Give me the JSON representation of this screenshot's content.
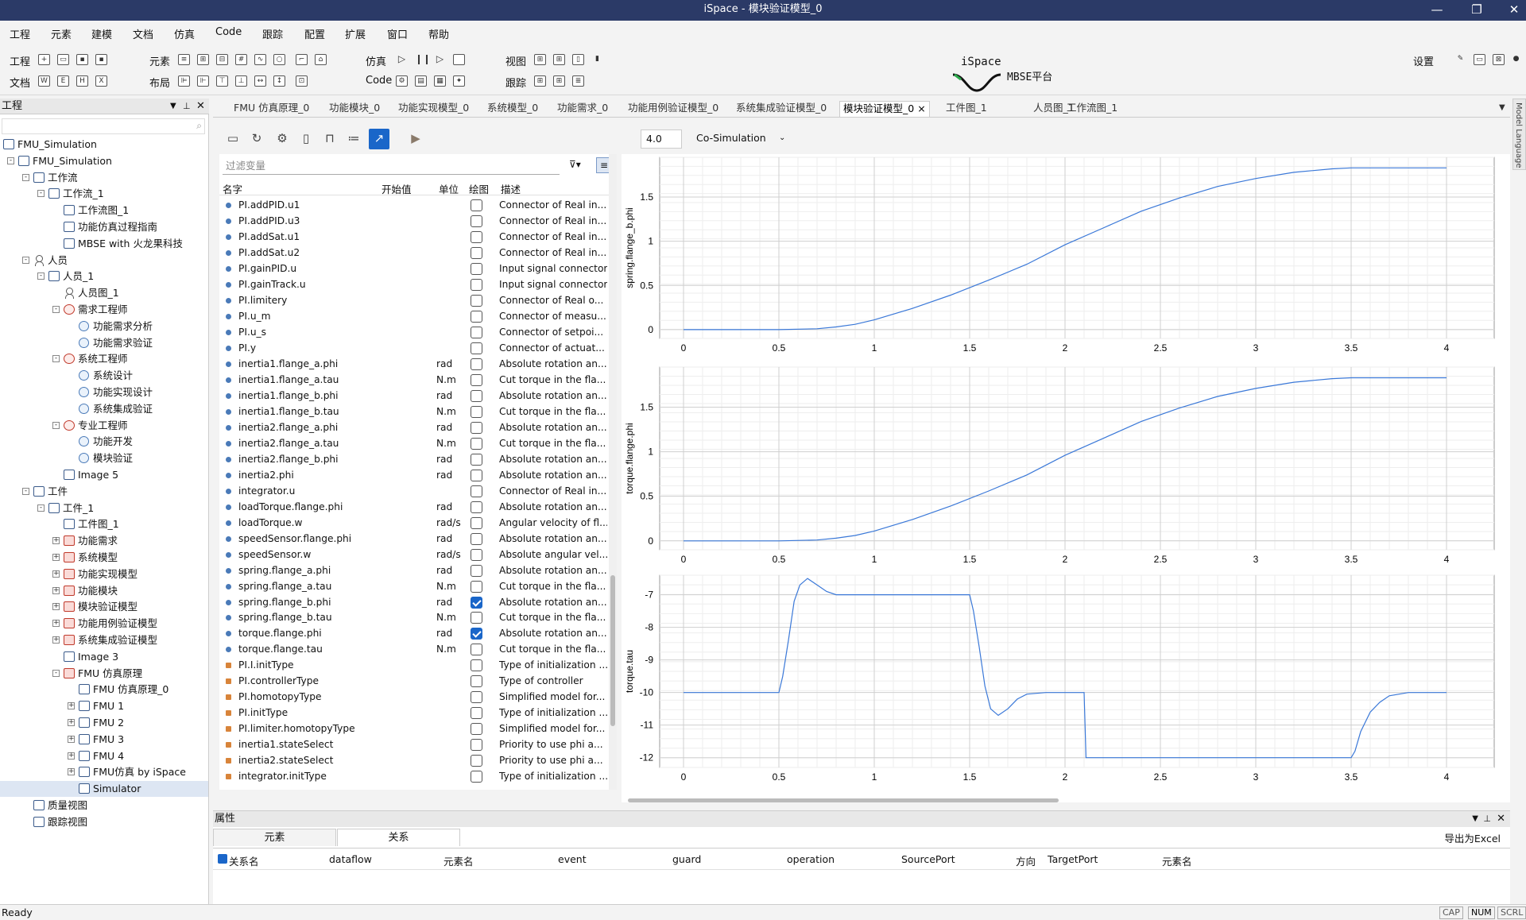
{
  "window": {
    "title": "iSpace - 模块验证模型_0"
  },
  "menu": [
    "工程",
    "元素",
    "建模",
    "文档",
    "仿真",
    "Code",
    "跟踪",
    "配置",
    "扩展",
    "窗口",
    "帮助"
  ],
  "toolbar": {
    "row1": {
      "project": "工程",
      "element": "元素",
      "simulation": "仿真",
      "view": "视图",
      "settings": "设置"
    },
    "row2": {
      "document": "文档",
      "layout": "布局",
      "code": "Code",
      "trace": "跟踪"
    }
  },
  "logo": {
    "text": "iSpace",
    "subtitle": "MBSE平台"
  },
  "left_panel": {
    "title": "工程",
    "tree": [
      {
        "label": "FMU_Simulation",
        "level": 0,
        "icon": "grid"
      },
      {
        "label": "FMU_Simulation",
        "level": 1,
        "icon": "folder",
        "exp": "-"
      },
      {
        "label": "工作流",
        "level": 2,
        "icon": "flow",
        "exp": "-"
      },
      {
        "label": "工作流_1",
        "level": 3,
        "icon": "folder",
        "exp": "-"
      },
      {
        "label": "工作流图_1",
        "level": 4,
        "icon": "diagram"
      },
      {
        "label": "功能仿真过程指南",
        "level": 4,
        "icon": "diagram"
      },
      {
        "label": "MBSE with 火龙果科技",
        "level": 4,
        "icon": "diagram"
      },
      {
        "label": "人员",
        "level": 2,
        "icon": "person",
        "exp": "-"
      },
      {
        "label": "人员_1",
        "level": 3,
        "icon": "folder",
        "exp": "-"
      },
      {
        "label": "人员图_1",
        "level": 4,
        "icon": "person"
      },
      {
        "label": "需求工程师",
        "level": 4,
        "icon": "role",
        "exp": "-"
      },
      {
        "label": "功能需求分析",
        "level": 5,
        "icon": "circle"
      },
      {
        "label": "功能需求验证",
        "level": 5,
        "icon": "circle"
      },
      {
        "label": "系统工程师",
        "level": 4,
        "icon": "role",
        "exp": "-"
      },
      {
        "label": "系统设计",
        "level": 5,
        "icon": "circle"
      },
      {
        "label": "功能实现设计",
        "level": 5,
        "icon": "circle"
      },
      {
        "label": "系统集成验证",
        "level": 5,
        "icon": "circle"
      },
      {
        "label": "专业工程师",
        "level": 4,
        "icon": "role",
        "exp": "-"
      },
      {
        "label": "功能开发",
        "level": 5,
        "icon": "circle"
      },
      {
        "label": "模块验证",
        "level": 5,
        "icon": "circle"
      },
      {
        "label": "Image 5",
        "level": 4,
        "icon": "diagram"
      },
      {
        "label": "工件",
        "level": 2,
        "icon": "doc",
        "exp": "-"
      },
      {
        "label": "工件_1",
        "level": 3,
        "icon": "folder",
        "exp": "-"
      },
      {
        "label": "工件图_1",
        "level": 4,
        "icon": "diagram"
      },
      {
        "label": "功能需求",
        "level": 4,
        "icon": "red",
        "exp": "+"
      },
      {
        "label": "系统模型",
        "level": 4,
        "icon": "red",
        "exp": "+"
      },
      {
        "label": "功能实现模型",
        "level": 4,
        "icon": "red",
        "exp": "+"
      },
      {
        "label": "功能模块",
        "level": 4,
        "icon": "red",
        "exp": "+"
      },
      {
        "label": "模块验证模型",
        "level": 4,
        "icon": "red",
        "exp": "+"
      },
      {
        "label": "功能用例验证模型",
        "level": 4,
        "icon": "red",
        "exp": "+"
      },
      {
        "label": "系统集成验证模型",
        "level": 4,
        "icon": "red",
        "exp": "+"
      },
      {
        "label": "Image 3",
        "level": 4,
        "icon": "diagram"
      },
      {
        "label": "FMU 仿真原理",
        "level": 4,
        "icon": "red",
        "exp": "-"
      },
      {
        "label": "FMU 仿真原理_0",
        "level": 5,
        "icon": "diagram"
      },
      {
        "label": "FMU 1",
        "level": 5,
        "icon": "box",
        "exp": "+"
      },
      {
        "label": "FMU 2",
        "level": 5,
        "icon": "box",
        "exp": "+"
      },
      {
        "label": "FMU 3",
        "level": 5,
        "icon": "box",
        "exp": "+"
      },
      {
        "label": "FMU 4",
        "level": 5,
        "icon": "box",
        "exp": "+"
      },
      {
        "label": "FMU仿真 by iSpace",
        "level": 5,
        "icon": "box",
        "exp": "+"
      },
      {
        "label": "Simulator",
        "level": 5,
        "icon": "diagram",
        "selected": true
      },
      {
        "label": "质量视图",
        "level": 2,
        "icon": "folder"
      },
      {
        "label": "跟踪视图",
        "level": 2,
        "icon": "folder"
      }
    ]
  },
  "tabs": [
    "FMU 仿真原理_0",
    "功能模块_0",
    "功能实现模型_0",
    "系统模型_0",
    "功能需求_0",
    "功能用例验证模型_0",
    "系统集成验证模型_0",
    "模块验证模型_0",
    "工件图_1",
    "人员图_1",
    "工作流图_1"
  ],
  "active_tab": "模块验证模型_0",
  "sim": {
    "stop_time": "4.0",
    "mode": "Co-Simulation",
    "filter_placeholder": "过滤变量"
  },
  "var_columns": {
    "name": "名字",
    "start": "开始值",
    "unit": "单位",
    "plot": "绘图",
    "desc": "描述"
  },
  "variables": [
    {
      "name": "PI.addPID.u1",
      "unit": "",
      "plot": false,
      "desc": "Connector of Real in...",
      "kind": "var"
    },
    {
      "name": "PI.addPID.u3",
      "unit": "",
      "plot": false,
      "desc": "Connector of Real in...",
      "kind": "var"
    },
    {
      "name": "PI.addSat.u1",
      "unit": "",
      "plot": false,
      "desc": "Connector of Real in...",
      "kind": "var"
    },
    {
      "name": "PI.addSat.u2",
      "unit": "",
      "plot": false,
      "desc": "Connector of Real in...",
      "kind": "var"
    },
    {
      "name": "PI.gainPID.u",
      "unit": "",
      "plot": false,
      "desc": "Input signal connector",
      "kind": "var"
    },
    {
      "name": "PI.gainTrack.u",
      "unit": "",
      "plot": false,
      "desc": "Input signal connector",
      "kind": "var"
    },
    {
      "name": "PI.limitery",
      "unit": "",
      "plot": false,
      "desc": "Connector of Real o...",
      "kind": "var"
    },
    {
      "name": "PI.u_m",
      "unit": "",
      "plot": false,
      "desc": "Connector of measu...",
      "kind": "var"
    },
    {
      "name": "PI.u_s",
      "unit": "",
      "plot": false,
      "desc": "Connector of setpoi...",
      "kind": "var"
    },
    {
      "name": "PI.y",
      "unit": "",
      "plot": false,
      "desc": "Connector of actuat...",
      "kind": "var"
    },
    {
      "name": "inertia1.flange_a.phi",
      "unit": "rad",
      "plot": false,
      "desc": "Absolute rotation an...",
      "kind": "var"
    },
    {
      "name": "inertia1.flange_a.tau",
      "unit": "N.m",
      "plot": false,
      "desc": "Cut torque in the fla...",
      "kind": "var"
    },
    {
      "name": "inertia1.flange_b.phi",
      "unit": "rad",
      "plot": false,
      "desc": "Absolute rotation an...",
      "kind": "var"
    },
    {
      "name": "inertia1.flange_b.tau",
      "unit": "N.m",
      "plot": false,
      "desc": "Cut torque in the fla...",
      "kind": "var"
    },
    {
      "name": "inertia2.flange_a.phi",
      "unit": "rad",
      "plot": false,
      "desc": "Absolute rotation an...",
      "kind": "var"
    },
    {
      "name": "inertia2.flange_a.tau",
      "unit": "N.m",
      "plot": false,
      "desc": "Cut torque in the fla...",
      "kind": "var"
    },
    {
      "name": "inertia2.flange_b.phi",
      "unit": "rad",
      "plot": false,
      "desc": "Absolute rotation an...",
      "kind": "var"
    },
    {
      "name": "inertia2.phi",
      "unit": "rad",
      "plot": false,
      "desc": "Absolute rotation an...",
      "kind": "var"
    },
    {
      "name": "integrator.u",
      "unit": "",
      "plot": false,
      "desc": "Connector of Real in...",
      "kind": "var"
    },
    {
      "name": "loadTorque.flange.phi",
      "unit": "rad",
      "plot": false,
      "desc": "Absolute rotation an...",
      "kind": "var"
    },
    {
      "name": "loadTorque.w",
      "unit": "rad/s",
      "plot": false,
      "desc": "Angular velocity of fl...",
      "kind": "var"
    },
    {
      "name": "speedSensor.flange.phi",
      "unit": "rad",
      "plot": false,
      "desc": "Absolute rotation an...",
      "kind": "var"
    },
    {
      "name": "speedSensor.w",
      "unit": "rad/s",
      "plot": false,
      "desc": "Absolute angular vel...",
      "kind": "var"
    },
    {
      "name": "spring.flange_a.phi",
      "unit": "rad",
      "plot": false,
      "desc": "Absolute rotation an...",
      "kind": "var"
    },
    {
      "name": "spring.flange_a.tau",
      "unit": "N.m",
      "plot": false,
      "desc": "Cut torque in the fla...",
      "kind": "var"
    },
    {
      "name": "spring.flange_b.phi",
      "unit": "rad",
      "plot": true,
      "desc": "Absolute rotation an...",
      "kind": "var"
    },
    {
      "name": "spring.flange_b.tau",
      "unit": "N.m",
      "plot": false,
      "desc": "Cut torque in the fla...",
      "kind": "var"
    },
    {
      "name": "torque.flange.phi",
      "unit": "rad",
      "plot": true,
      "desc": "Absolute rotation an...",
      "kind": "var"
    },
    {
      "name": "torque.flange.tau",
      "unit": "N.m",
      "plot": false,
      "desc": "Cut torque in the fla...",
      "kind": "var"
    },
    {
      "name": "PI.I.initType",
      "unit": "",
      "plot": false,
      "desc": "Type of initialization ...",
      "kind": "param"
    },
    {
      "name": "PI.controllerType",
      "unit": "",
      "plot": false,
      "desc": "Type of controller",
      "kind": "param"
    },
    {
      "name": "PI.homotopyType",
      "unit": "",
      "plot": false,
      "desc": "Simplified model for...",
      "kind": "param"
    },
    {
      "name": "PI.initType",
      "unit": "",
      "plot": false,
      "desc": "Type of initialization ...",
      "kind": "param"
    },
    {
      "name": "PI.limiter.homotopyType",
      "unit": "",
      "plot": false,
      "desc": "Simplified model for...",
      "kind": "param"
    },
    {
      "name": "inertia1.stateSelect",
      "unit": "",
      "plot": false,
      "desc": "Priority to use phi a...",
      "kind": "param"
    },
    {
      "name": "inertia2.stateSelect",
      "unit": "",
      "plot": false,
      "desc": "Priority to use phi a...",
      "kind": "param"
    },
    {
      "name": "integrator.initType",
      "unit": "",
      "plot": false,
      "desc": "Type of initialization ...",
      "kind": "param"
    }
  ],
  "chart_data": [
    {
      "type": "line",
      "ylabel": "spring.flange_b.phi",
      "xlim": [
        0,
        4
      ],
      "ylim": [
        -0.1,
        1.95
      ],
      "xticks": [
        "0",
        "0.5",
        "1",
        "1.5",
        "2",
        "2.5",
        "3",
        "3.5",
        "4"
      ],
      "yticks": [
        "0",
        "0.5",
        "1",
        "1.5"
      ],
      "ytick_vals": [
        0,
        0.5,
        1,
        1.5
      ],
      "x": [
        0,
        0.5,
        0.7,
        0.8,
        0.9,
        1.0,
        1.2,
        1.4,
        1.6,
        1.8,
        2.0,
        2.2,
        2.4,
        2.6,
        2.8,
        3.0,
        3.2,
        3.4,
        3.5,
        3.6,
        3.8,
        4.0
      ],
      "y": [
        0,
        0,
        0.01,
        0.03,
        0.06,
        0.11,
        0.24,
        0.39,
        0.56,
        0.74,
        0.96,
        1.15,
        1.34,
        1.49,
        1.62,
        1.71,
        1.78,
        1.82,
        1.83,
        1.83,
        1.83,
        1.83
      ]
    },
    {
      "type": "line",
      "ylabel": "torque.flange.phi",
      "xlim": [
        0,
        4
      ],
      "ylim": [
        -0.1,
        1.95
      ],
      "xticks": [
        "0",
        "0.5",
        "1",
        "1.5",
        "2",
        "2.5",
        "3",
        "3.5",
        "4"
      ],
      "yticks": [
        "0",
        "0.5",
        "1",
        "1.5"
      ],
      "ytick_vals": [
        0,
        0.5,
        1,
        1.5
      ],
      "x": [
        0,
        0.5,
        0.7,
        0.8,
        0.9,
        1.0,
        1.2,
        1.4,
        1.6,
        1.8,
        2.0,
        2.2,
        2.4,
        2.6,
        2.8,
        3.0,
        3.2,
        3.4,
        3.5,
        3.6,
        3.8,
        4.0
      ],
      "y": [
        0,
        0,
        0.01,
        0.03,
        0.06,
        0.11,
        0.24,
        0.39,
        0.56,
        0.74,
        0.96,
        1.15,
        1.34,
        1.49,
        1.62,
        1.71,
        1.78,
        1.82,
        1.83,
        1.83,
        1.83,
        1.83
      ]
    },
    {
      "type": "line",
      "ylabel": "torque.tau",
      "xlim": [
        0,
        4
      ],
      "ylim": [
        -12.3,
        -6.4
      ],
      "xticks": [
        "0",
        "0.5",
        "1",
        "1.5",
        "2",
        "2.5",
        "3",
        "3.5",
        "4"
      ],
      "yticks": [
        "-7",
        "-8",
        "-9",
        "-10",
        "-11",
        "-12"
      ],
      "ytick_vals": [
        -7,
        -8,
        -9,
        -10,
        -11,
        -12
      ],
      "x": [
        0,
        0.5,
        0.52,
        0.55,
        0.58,
        0.61,
        0.65,
        0.7,
        0.75,
        0.8,
        0.9,
        1.0,
        1.5,
        1.52,
        1.55,
        1.58,
        1.61,
        1.65,
        1.7,
        1.75,
        1.8,
        1.9,
        2.0,
        2.1,
        2.11,
        2.14,
        3.5,
        3.52,
        3.55,
        3.6,
        3.65,
        3.7,
        3.8,
        4.0
      ],
      "y": [
        -10,
        -10,
        -9.5,
        -8.4,
        -7.2,
        -6.7,
        -6.5,
        -6.7,
        -6.9,
        -7.0,
        -7.0,
        -7.0,
        -7.0,
        -7.5,
        -8.6,
        -9.8,
        -10.5,
        -10.7,
        -10.5,
        -10.2,
        -10.05,
        -10.0,
        -10.0,
        -10.0,
        -12.0,
        -12.0,
        -12.0,
        -11.8,
        -11.2,
        -10.6,
        -10.3,
        -10.1,
        -10.0,
        -10.0
      ]
    }
  ],
  "properties": {
    "title": "属性",
    "tabs": [
      "元素",
      "关系"
    ],
    "export": "导出为Excel",
    "columns": [
      "关系名",
      "dataflow",
      "元素名",
      "event",
      "guard",
      "operation",
      "SourcePort",
      "方向",
      "TargetPort",
      "元素名"
    ]
  },
  "status": {
    "text": "Ready",
    "indicators": [
      "CAP",
      "NUM",
      "SCRL"
    ]
  },
  "right_strip": "Model Language"
}
